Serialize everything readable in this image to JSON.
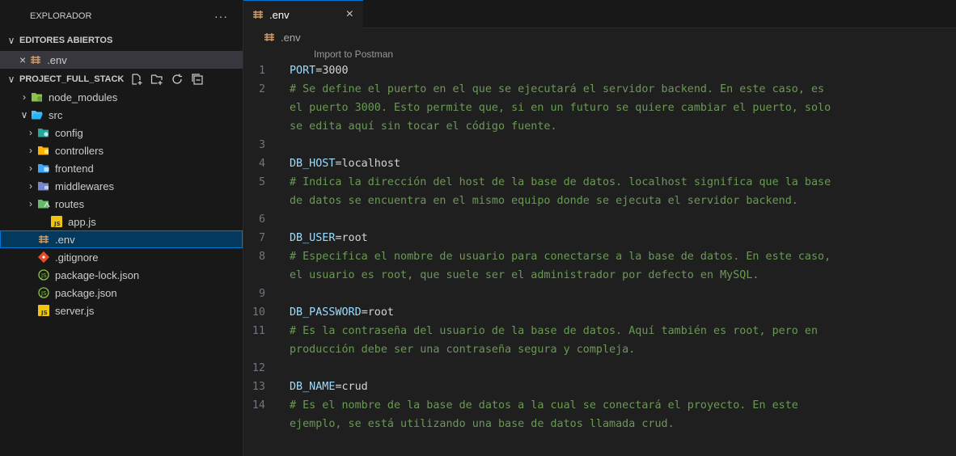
{
  "sidebar": {
    "title": "EXPLORADOR",
    "more": "···",
    "open_editors": {
      "header": "EDITORES ABIERTOS",
      "items": [
        {
          "label": ".env"
        }
      ]
    },
    "project": {
      "header": "PROJECT_FULL_STACK",
      "items": [
        {
          "label": "node_modules"
        },
        {
          "label": "src"
        },
        {
          "label": "config"
        },
        {
          "label": "controllers"
        },
        {
          "label": "frontend"
        },
        {
          "label": "middlewares"
        },
        {
          "label": "routes"
        },
        {
          "label": "app.js"
        },
        {
          "label": ".env"
        },
        {
          "label": ".gitignore"
        },
        {
          "label": "package-lock.json"
        },
        {
          "label": "package.json"
        },
        {
          "label": "server.js"
        }
      ]
    }
  },
  "editor": {
    "tab": {
      "label": ".env",
      "close": "×"
    },
    "breadcrumb": ".env",
    "codelens": "Import to Postman",
    "lines": [
      {
        "n": "1",
        "key": "PORT",
        "eq": "=",
        "val": "3000"
      },
      {
        "n": "2",
        "cmt": "# Se define el puerto en el que se ejecutará el servidor backend. En este caso, es"
      },
      {
        "n": "",
        "cmt": "el puerto 3000. Esto permite que, si en un futuro se quiere cambiar el puerto, solo"
      },
      {
        "n": "",
        "cmt": "se edita aquí sin tocar el código fuente."
      },
      {
        "n": "3"
      },
      {
        "n": "4",
        "key": "DB_HOST",
        "eq": "=",
        "val": "localhost"
      },
      {
        "n": "5",
        "cmt": "# Indica la dirección del host de la base de datos. localhost significa que la base"
      },
      {
        "n": "",
        "cmt": "de datos se encuentra en el mismo equipo donde se ejecuta el servidor backend."
      },
      {
        "n": "6"
      },
      {
        "n": "7",
        "key": "DB_USER",
        "eq": "=",
        "val": "root"
      },
      {
        "n": "8",
        "cmt": "# Especifica el nombre de usuario para conectarse a la base de datos. En este caso,"
      },
      {
        "n": "",
        "cmt": "el usuario es root, que suele ser el administrador por defecto en MySQL."
      },
      {
        "n": "9"
      },
      {
        "n": "10",
        "key": "DB_PASSWORD",
        "eq": "=",
        "val": "root"
      },
      {
        "n": "11",
        "cmt": "# Es la contraseña del usuario de la base de datos. Aquí también es root, pero en"
      },
      {
        "n": "",
        "cmt": "producción debe ser una contraseña segura y compleja."
      },
      {
        "n": "12"
      },
      {
        "n": "13",
        "key": "DB_NAME",
        "eq": "=",
        "val": "crud"
      },
      {
        "n": "14",
        "cmt": "# Es el nombre de la base de datos a la cual se conectará el proyecto. En este"
      },
      {
        "n": "",
        "cmt": "ejemplo, se está utilizando una base de datos llamada crud."
      }
    ]
  },
  "colors": {
    "accent": "#0078d4",
    "comment": "#6a9955",
    "key": "#9cdcfe",
    "js": "#f1c40f",
    "git": "#e44d26"
  }
}
